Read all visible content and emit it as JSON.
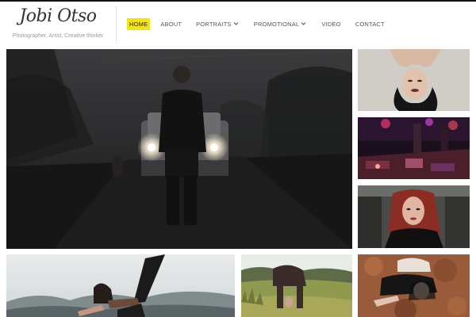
{
  "site": {
    "title": "Jobi Otso",
    "tagline": "Photographer, Artist, Creative thinker"
  },
  "nav": [
    {
      "label": "HOME",
      "active": true,
      "has_dropdown": false
    },
    {
      "label": "ABOUT",
      "active": false,
      "has_dropdown": false
    },
    {
      "label": "PORTRAITS",
      "active": false,
      "has_dropdown": true
    },
    {
      "label": "PROMOTIONAL",
      "active": false,
      "has_dropdown": true
    },
    {
      "label": "VIDEO",
      "active": false,
      "has_dropdown": false
    },
    {
      "label": "CONTACT",
      "active": false,
      "has_dropdown": false
    }
  ],
  "colors": {
    "nav_active_bg": "#f5e50e",
    "text": "#555555",
    "accent_bar": "#111111"
  },
  "gallery": [
    {
      "subject": "man standing on foggy road in front of car headlights"
    },
    {
      "subject": "woman lying on sand with dark hair"
    },
    {
      "subject": "concert stage with red and purple lights"
    },
    {
      "subject": "red-haired woman in car"
    },
    {
      "subject": "woman in yoga pose with raised leg over valley"
    },
    {
      "subject": "person bending in grass field"
    },
    {
      "subject": "woman lying on rocky ground"
    }
  ]
}
